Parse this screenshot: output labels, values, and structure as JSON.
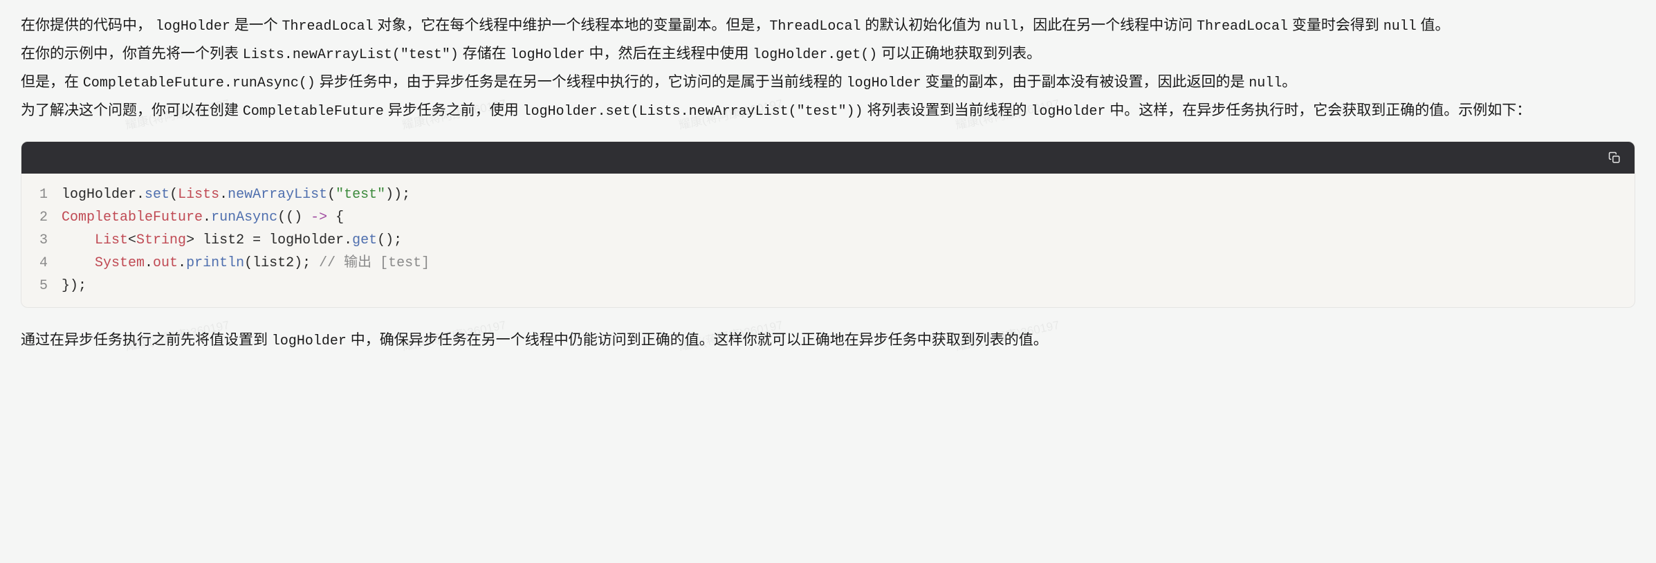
{
  "prose": {
    "p1a": "在你提供的代码中， ",
    "p1_code1": "logHolder",
    "p1b": " 是一个 ",
    "p1_code2": "ThreadLocal",
    "p1c": " 对象，它在每个线程中维护一个线程本地的变量副本。但是，",
    "p1_code3": "ThreadLocal",
    "p1d": " 的默认初始化值为 ",
    "p1_code4": "null",
    "p1e": "，因此在另一个线程中访问 ",
    "p1_code5": "ThreadLocal",
    "p1f": " 变量时会得到 ",
    "p1_code6": "null",
    "p1g": " 值。",
    "p2a": "在你的示例中，你首先将一个列表 ",
    "p2_code1": "Lists.newArrayList(\"test\")",
    "p2b": " 存储在 ",
    "p2_code2": "logHolder",
    "p2c": " 中，然后在主线程中使用 ",
    "p2_code3": "logHolder.get()",
    "p2d": " 可以正确地获取到列表。",
    "p3a": "但是，在 ",
    "p3_code1": "CompletableFuture.runAsync()",
    "p3b": " 异步任务中，由于异步任务是在另一个线程中执行的，它访问的是属于当前线程的 ",
    "p3_code2": "logHolder",
    "p3c": " 变量的副本，由于副本没有被设置，因此返回的是 ",
    "p3_code3": "null",
    "p3d": "。",
    "p4a": "为了解决这个问题，你可以在创建 ",
    "p4_code1": "CompletableFuture",
    "p4b": " 异步任务之前，使用 ",
    "p4_code2": "logHolder.set(Lists.newArrayList(\"test\"))",
    "p4c": " 将列表设置到当前线程的 ",
    "p4_code3": "logHolder",
    "p4d": " 中。这样，在异步任务执行时，它会获取到正确的值。示例如下：",
    "p5a": "通过在异步任务执行之前先将值设置到 ",
    "p5_code1": "logHolder",
    "p5b": " 中，确保异步任务在另一个线程中仍能访问到正确的值。这样你就可以正确地在异步任务中获取到列表的值。"
  },
  "code": {
    "lines": [
      {
        "n": "1",
        "tokens": [
          {
            "t": "logHolder",
            "c": "tok-id"
          },
          {
            "t": ".",
            "c": "tok-punc"
          },
          {
            "t": "set",
            "c": "tok-call"
          },
          {
            "t": "(",
            "c": "tok-punc"
          },
          {
            "t": "Lists",
            "c": "tok-type"
          },
          {
            "t": ".",
            "c": "tok-punc"
          },
          {
            "t": "newArrayList",
            "c": "tok-call"
          },
          {
            "t": "(",
            "c": "tok-punc"
          },
          {
            "t": "\"test\"",
            "c": "tok-str"
          },
          {
            "t": "));",
            "c": "tok-punc"
          }
        ]
      },
      {
        "n": "2",
        "tokens": [
          {
            "t": "CompletableFuture",
            "c": "tok-type"
          },
          {
            "t": ".",
            "c": "tok-punc"
          },
          {
            "t": "runAsync",
            "c": "tok-call"
          },
          {
            "t": "(() ",
            "c": "tok-punc"
          },
          {
            "t": "->",
            "c": "tok-op"
          },
          {
            "t": " {",
            "c": "tok-punc"
          }
        ]
      },
      {
        "n": "3",
        "tokens": [
          {
            "t": "    ",
            "c": "tok-punc"
          },
          {
            "t": "List",
            "c": "tok-type"
          },
          {
            "t": "<",
            "c": "tok-punc"
          },
          {
            "t": "String",
            "c": "tok-type"
          },
          {
            "t": "> list2 = logHolder.",
            "c": "tok-punc"
          },
          {
            "t": "get",
            "c": "tok-call"
          },
          {
            "t": "();",
            "c": "tok-punc"
          }
        ]
      },
      {
        "n": "4",
        "tokens": [
          {
            "t": "    ",
            "c": "tok-punc"
          },
          {
            "t": "System",
            "c": "tok-type"
          },
          {
            "t": ".",
            "c": "tok-punc"
          },
          {
            "t": "out",
            "c": "tok-kw"
          },
          {
            "t": ".",
            "c": "tok-punc"
          },
          {
            "t": "println",
            "c": "tok-call"
          },
          {
            "t": "(list2); ",
            "c": "tok-punc"
          },
          {
            "t": "// 输出 [test]",
            "c": "tok-cmt"
          }
        ]
      },
      {
        "n": "5",
        "tokens": [
          {
            "t": "});",
            "c": "tok-punc"
          }
        ]
      }
    ]
  },
  "watermark": "耀康(蒋阿康)360197"
}
